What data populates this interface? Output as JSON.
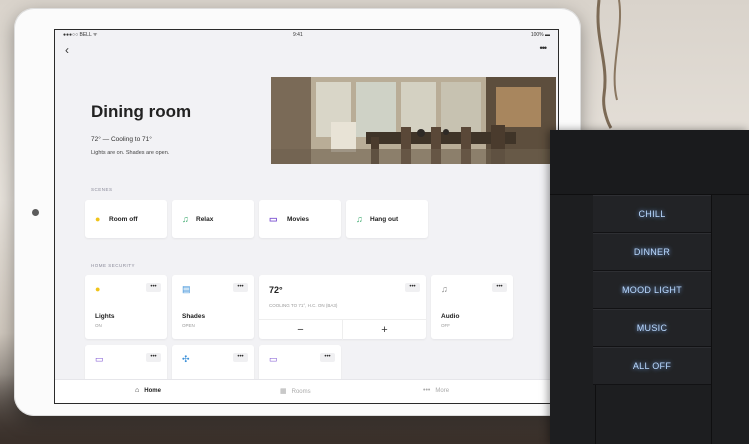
{
  "status_bar": {
    "left": "●●●○○ BELL ᯤ",
    "time": "9:41",
    "battery": "100% ▬"
  },
  "header": {
    "back_icon": "chevron-left-icon",
    "more_icon": "more-icon"
  },
  "room": {
    "title": "Dining room",
    "temperature": "72° — Cooling to 71°",
    "status": "Lights are on. Shades are open."
  },
  "scenes": {
    "section_label": "SCENES",
    "items": [
      {
        "label": "Room off",
        "icon": "sun-icon"
      },
      {
        "label": "Relax",
        "icon": "music-note-icon"
      },
      {
        "label": "Movies",
        "icon": "tv-icon"
      },
      {
        "label": "Hang out",
        "icon": "music-note-icon"
      }
    ]
  },
  "home_security": {
    "section_label": "HOME SECURITY",
    "devices": [
      {
        "name": "Lights",
        "sub": "ON",
        "icon": "bulb-icon"
      },
      {
        "name": "Shades",
        "sub": "OPEN",
        "icon": "shades-icon"
      },
      {
        "name": "Audio",
        "sub": "OFF",
        "icon": "music-note-icon"
      }
    ],
    "thermostat": {
      "value": "72°",
      "desc": "COOLING TO 71°, H.C. ON (BA3)",
      "minus": "−",
      "plus": "+"
    },
    "more_label": "•••",
    "row2": [
      {
        "icon": "tv-icon"
      },
      {
        "icon": "fan-icon"
      },
      {
        "icon": "screen-icon"
      }
    ]
  },
  "tabbar": {
    "tabs": [
      {
        "label": "Home",
        "icon": "home-icon",
        "active": true
      },
      {
        "label": "Rooms",
        "icon": "grid-icon",
        "active": false
      },
      {
        "label": "More",
        "icon": "more-icon",
        "active": false
      }
    ]
  },
  "keypad": {
    "buttons": [
      "CHILL",
      "DINNER",
      "MOOD LIGHT",
      "MUSIC",
      "ALL OFF"
    ],
    "glow_color": "#b9d9ff"
  }
}
